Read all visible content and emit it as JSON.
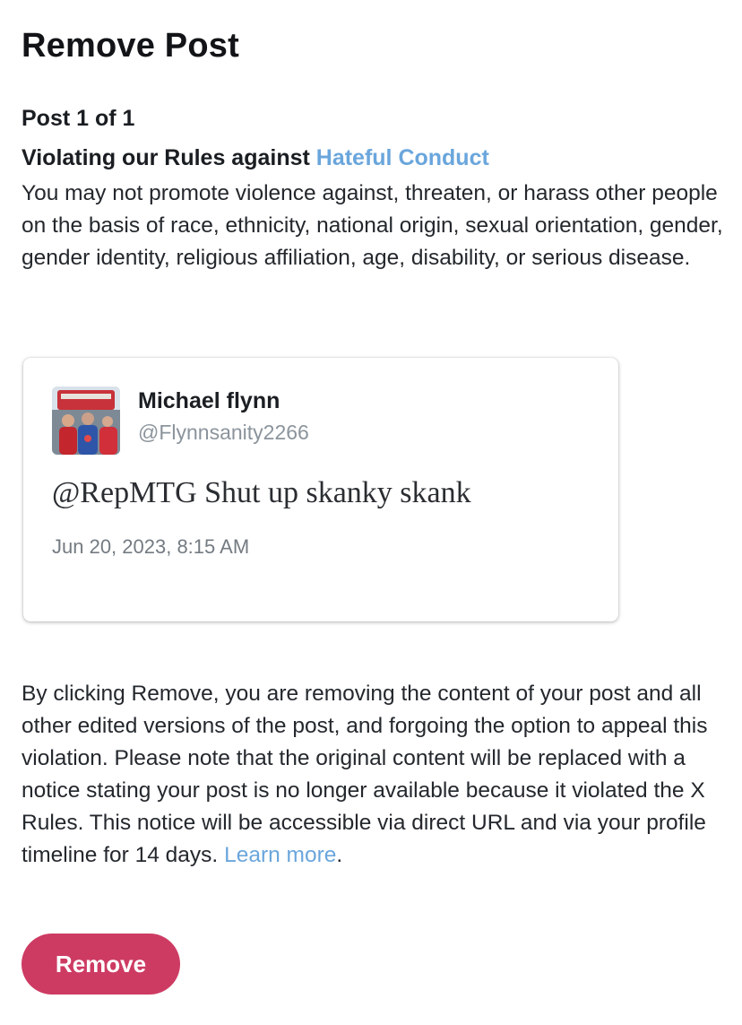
{
  "page": {
    "title": "Remove Post",
    "counter": "Post 1 of 1"
  },
  "violation": {
    "heading_prefix": "Violating our Rules against ",
    "rule_link": "Hateful Conduct",
    "description": "You may not promote violence against, threaten, or harass other people on the basis of race, ethnicity, national origin, sexual orientation, gender, gender identity, religious affiliation, age, disability, or serious disease."
  },
  "tweet": {
    "author_name": "Michael flynn",
    "author_handle": "@Flynnsanity2266",
    "text": "@RepMTG Shut up skanky skank",
    "timestamp": "Jun 20, 2023, 8:15 AM",
    "avatar_icon": "user-avatar-photo"
  },
  "notice": {
    "text": "By clicking Remove, you are removing the content of your post and all other edited versions of the post, and forgoing the option to appeal this violation. Please note that the original content will be replaced with a notice stating your post is no longer available because it violated the X Rules. This notice will be accessible via direct URL and via your profile timeline for 14 days. ",
    "learn_more": "Learn more",
    "trailing": "."
  },
  "actions": {
    "remove_label": "Remove"
  },
  "colors": {
    "link": "#6aa6dc",
    "remove_button": "#cd3b63",
    "handle": "#8b949c"
  }
}
